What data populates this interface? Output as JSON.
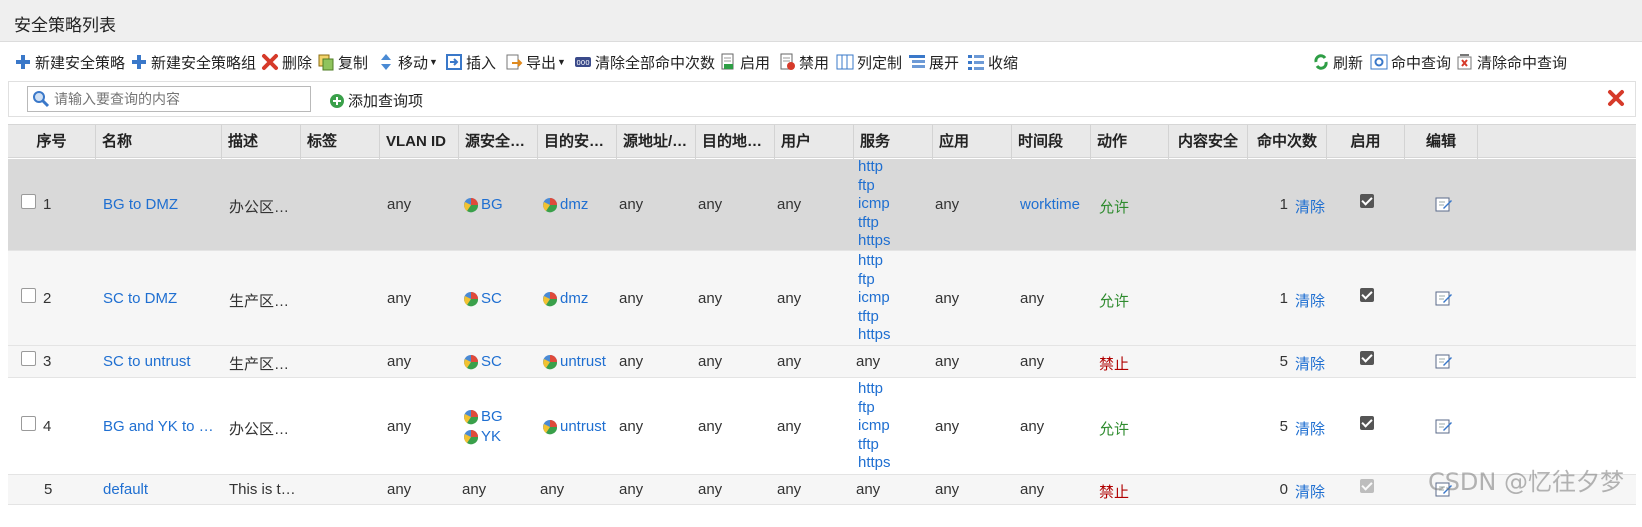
{
  "page": {
    "title": "安全策略列表"
  },
  "toolbar": {
    "new_policy": "新建安全策略",
    "new_policy_group": "新建安全策略组",
    "delete": "删除",
    "copy": "复制",
    "move": "移动",
    "insert": "插入",
    "export": "导出",
    "clear_hits": "清除全部命中次数",
    "enable": "启用",
    "disable": "禁用",
    "columns": "列定制",
    "expand": "展开",
    "collapse": "收缩",
    "refresh": "刷新",
    "hit_query": "命中查询",
    "clear_hit_query": "清除命中查询"
  },
  "search": {
    "placeholder": "请输入要查询的内容",
    "add_query": "添加查询项"
  },
  "columns": [
    "序号",
    "名称",
    "描述",
    "标签",
    "VLAN ID",
    "源安全…",
    "目的安…",
    "源地址/…",
    "目的地…",
    "用户",
    "服务",
    "应用",
    "时间段",
    "动作",
    "内容安全",
    "命中次数",
    "启用",
    "编辑"
  ],
  "rows": [
    {
      "no": "1",
      "name": "BG to DMZ",
      "desc": "办公区…",
      "vlan": "any",
      "src_zone": [
        "BG"
      ],
      "dst_zone": [
        "dmz"
      ],
      "src_addr": "any",
      "dst_addr": "any",
      "user": "any",
      "service": [
        "http",
        "ftp",
        "icmp",
        "tftp",
        "https"
      ],
      "app": "any",
      "time": "worktime",
      "action": "允许",
      "hits": "1",
      "clear": "清除"
    },
    {
      "no": "2",
      "name": "SC to DMZ",
      "desc": "生产区…",
      "vlan": "any",
      "src_zone": [
        "SC"
      ],
      "dst_zone": [
        "dmz"
      ],
      "src_addr": "any",
      "dst_addr": "any",
      "user": "any",
      "service": [
        "http",
        "ftp",
        "icmp",
        "tftp",
        "https"
      ],
      "app": "any",
      "time": "any",
      "action": "允许",
      "hits": "1",
      "clear": "清除"
    },
    {
      "no": "3",
      "name": "SC to untrust",
      "desc": "生产区…",
      "vlan": "any",
      "src_zone": [
        "SC"
      ],
      "dst_zone": [
        "untrust"
      ],
      "src_addr": "any",
      "dst_addr": "any",
      "user": "any",
      "service": [
        "any"
      ],
      "app": "any",
      "time": "any",
      "action": "禁止",
      "hits": "5",
      "clear": "清除"
    },
    {
      "no": "4",
      "name": "BG and YK to …",
      "desc": "办公区…",
      "vlan": "any",
      "src_zone": [
        "BG",
        "YK"
      ],
      "dst_zone": [
        "untrust"
      ],
      "src_addr": "any",
      "dst_addr": "any",
      "user": "any",
      "service": [
        "http",
        "ftp",
        "icmp",
        "tftp",
        "https"
      ],
      "app": "any",
      "time": "any",
      "action": "允许",
      "hits": "5",
      "clear": "清除"
    },
    {
      "no": "5",
      "name": "default",
      "desc": "This is t…",
      "vlan": "any",
      "src_zone_text": "any",
      "dst_zone_text": "any",
      "src_addr": "any",
      "dst_addr": "any",
      "user": "any",
      "service": [
        "any"
      ],
      "app": "any",
      "time": "any",
      "action": "禁止",
      "hits": "0",
      "clear": "清除"
    }
  ],
  "colors": {
    "link": "#1f6fd1",
    "allow": "#2e8b2e",
    "deny": "#b00000",
    "selected_row": "#d9d9d9",
    "header": "#e9e9e9"
  },
  "watermark": "CSDN @忆往夕梦"
}
